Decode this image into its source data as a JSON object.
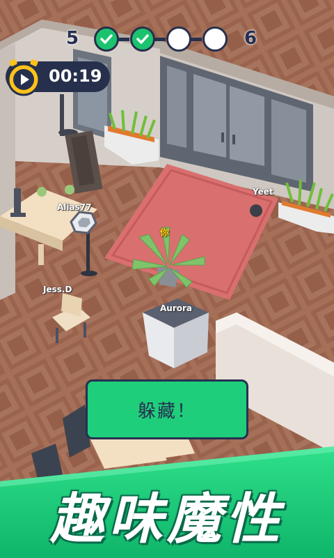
{
  "hud": {
    "level_current": "5",
    "level_next": "6",
    "steps": [
      {
        "state": "done"
      },
      {
        "state": "done"
      },
      {
        "state": "pending"
      },
      {
        "state": "pending"
      }
    ]
  },
  "timer": {
    "time": "00:19"
  },
  "players": {
    "you": "你",
    "yeet": "Yeet",
    "alias": "Alias77",
    "jess": "Jess.D",
    "aurora": "Aurora"
  },
  "actions": {
    "hide_label": "躲藏！"
  },
  "banner": {
    "text": "趣味魔性"
  },
  "colors": {
    "accent_green": "#1fce7a",
    "navy": "#263050",
    "floor": "#9e6a55",
    "rug": "#d96f6f"
  }
}
